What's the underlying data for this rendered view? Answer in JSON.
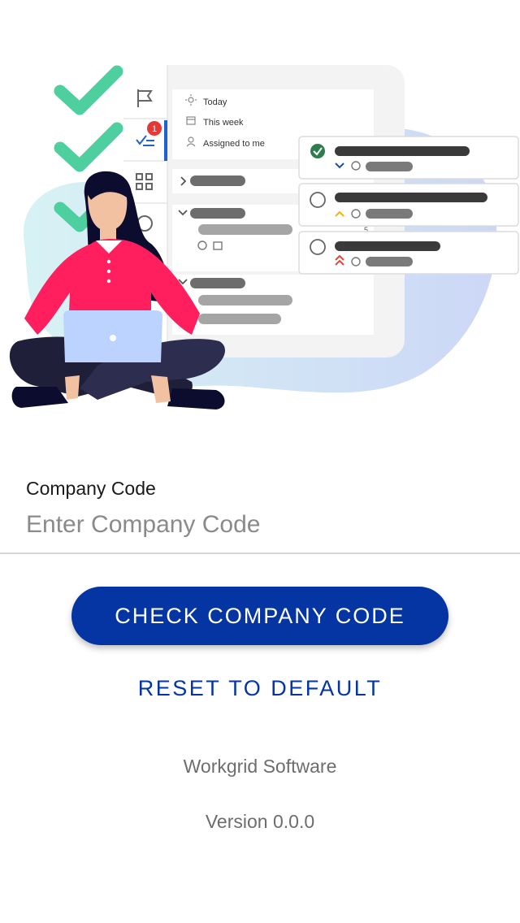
{
  "illustration": {
    "filter_items": [
      {
        "icon": "sun-icon",
        "label": "Today"
      },
      {
        "icon": "calendar-icon",
        "label": "This week"
      },
      {
        "icon": "person-icon",
        "label": "Assigned to me"
      }
    ],
    "notification_count": "1",
    "small_number": "5",
    "colors": {
      "checkmark": "#4ecf9f",
      "blob": "#d4e4fb",
      "shirt": "#ff1f5e",
      "pants": "#1f1f3a",
      "accent": "#2060d0"
    }
  },
  "form": {
    "company_code_label": "Company Code",
    "company_code_placeholder": "Enter Company Code",
    "company_code_value": ""
  },
  "actions": {
    "check_label": "CHECK COMPANY CODE",
    "reset_label": "RESET TO DEFAULT"
  },
  "footer": {
    "company": "Workgrid Software",
    "version": "Version 0.0.0"
  },
  "colors": {
    "primary": "#0435a3",
    "muted_text": "#6d6d6d"
  }
}
